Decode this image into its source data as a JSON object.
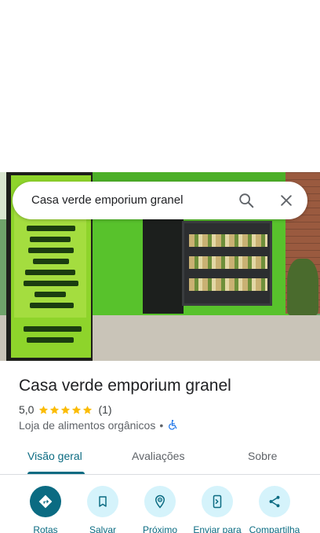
{
  "search": {
    "query": "Casa verde emporium granel"
  },
  "place": {
    "name": "Casa verde emporium granel",
    "rating": "5,0",
    "stars": 5,
    "review_count": "(1)",
    "category": "Loja de alimentos orgânicos",
    "separator": "•"
  },
  "tabs": [
    {
      "label": "Visão geral",
      "active": true
    },
    {
      "label": "Avaliações",
      "active": false
    },
    {
      "label": "Sobre",
      "active": false
    }
  ],
  "actions": [
    {
      "label": "Rotas",
      "icon": "directions-icon"
    },
    {
      "label": "Salvar",
      "icon": "bookmark-icon"
    },
    {
      "label": "Próximo",
      "icon": "nearby-icon"
    },
    {
      "label": "Enviar para",
      "icon": "send-to-phone-icon"
    },
    {
      "label": "Compartilha",
      "icon": "share-icon"
    }
  ],
  "colors": {
    "accent": "#0b6b82",
    "accent_light": "#d5f3fb",
    "star": "#fbbc04",
    "accessible": "#1a73e8"
  }
}
